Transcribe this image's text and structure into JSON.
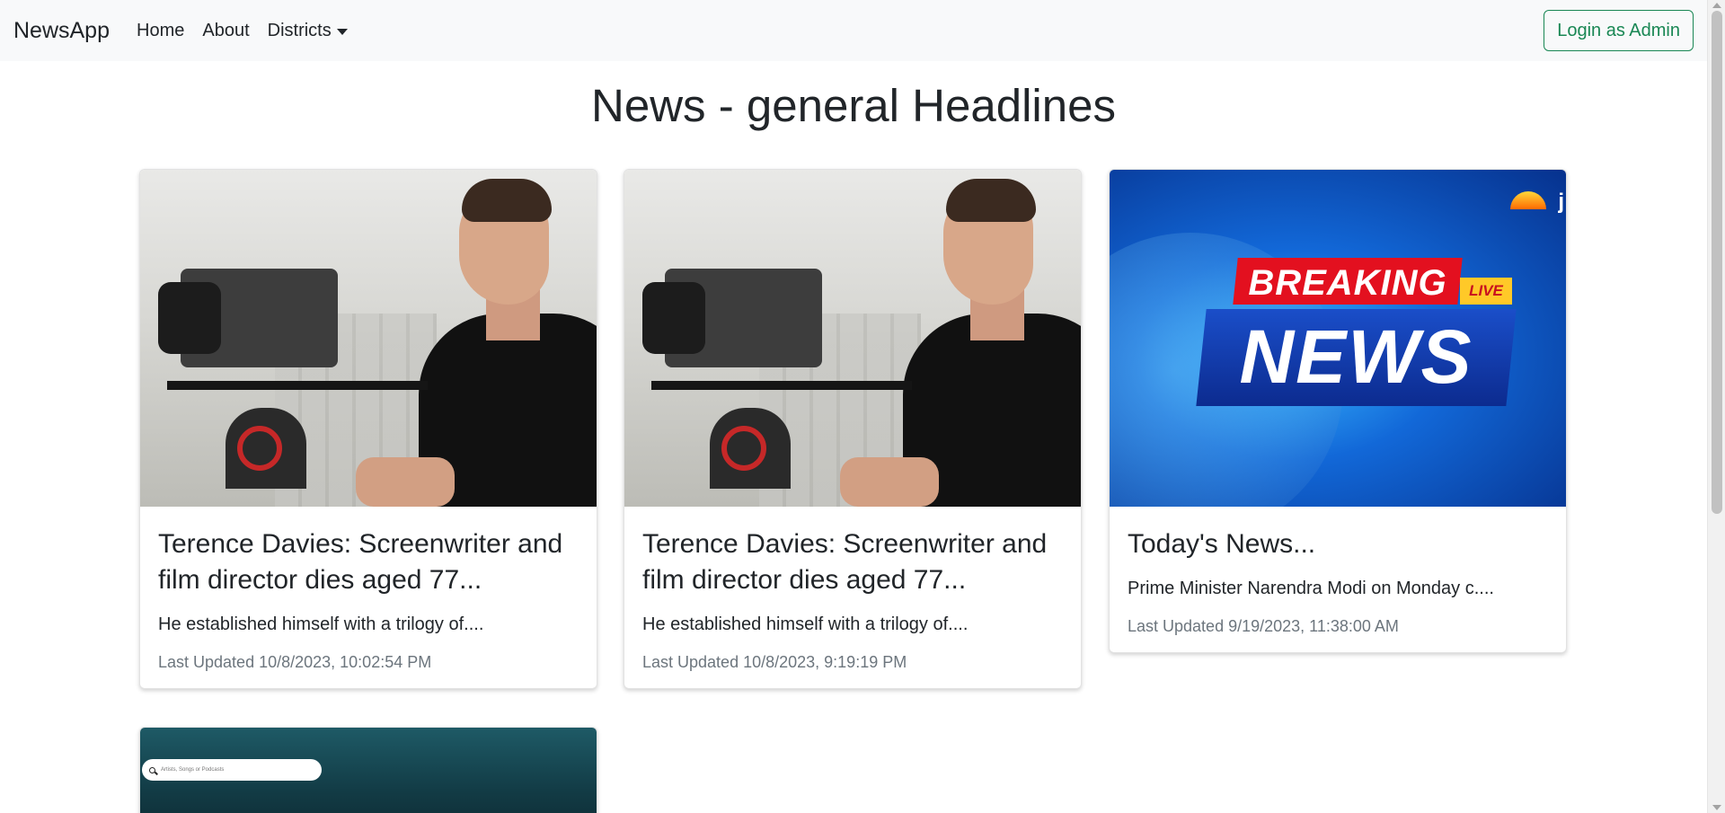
{
  "navbar": {
    "brand": "NewsApp",
    "links": [
      "Home",
      "About",
      "Districts"
    ],
    "login_label": "Login as Admin",
    "accent_color": "#198754"
  },
  "page": {
    "title": "News - general Headlines"
  },
  "cards": [
    {
      "title": "Terence Davies: Screenwriter and film director dies aged 77...",
      "description": "He established himself with a trilogy of....",
      "meta": "Last Updated 10/8/2023, 10:02:54 PM",
      "image": "cameraman-photo"
    },
    {
      "title": "Terence Davies: Screenwriter and film director dies aged 77...",
      "description": "He established himself with a trilogy of....",
      "meta": "Last Updated 10/8/2023, 9:19:19 PM",
      "image": "cameraman-photo"
    },
    {
      "title": "Today's News...",
      "description": "Prime Minister Narendra Modi on Monday c....",
      "meta": "Last Updated 9/19/2023, 11:38:00 AM",
      "image": "breaking-news-graphic",
      "graphic_text": {
        "top": "BREAKING",
        "badge": "LIVE",
        "main": "NEWS",
        "corner": "j"
      }
    },
    {
      "image": "music-app-screenshot",
      "search_placeholder": "Artists, Songs or Podcasts"
    }
  ]
}
